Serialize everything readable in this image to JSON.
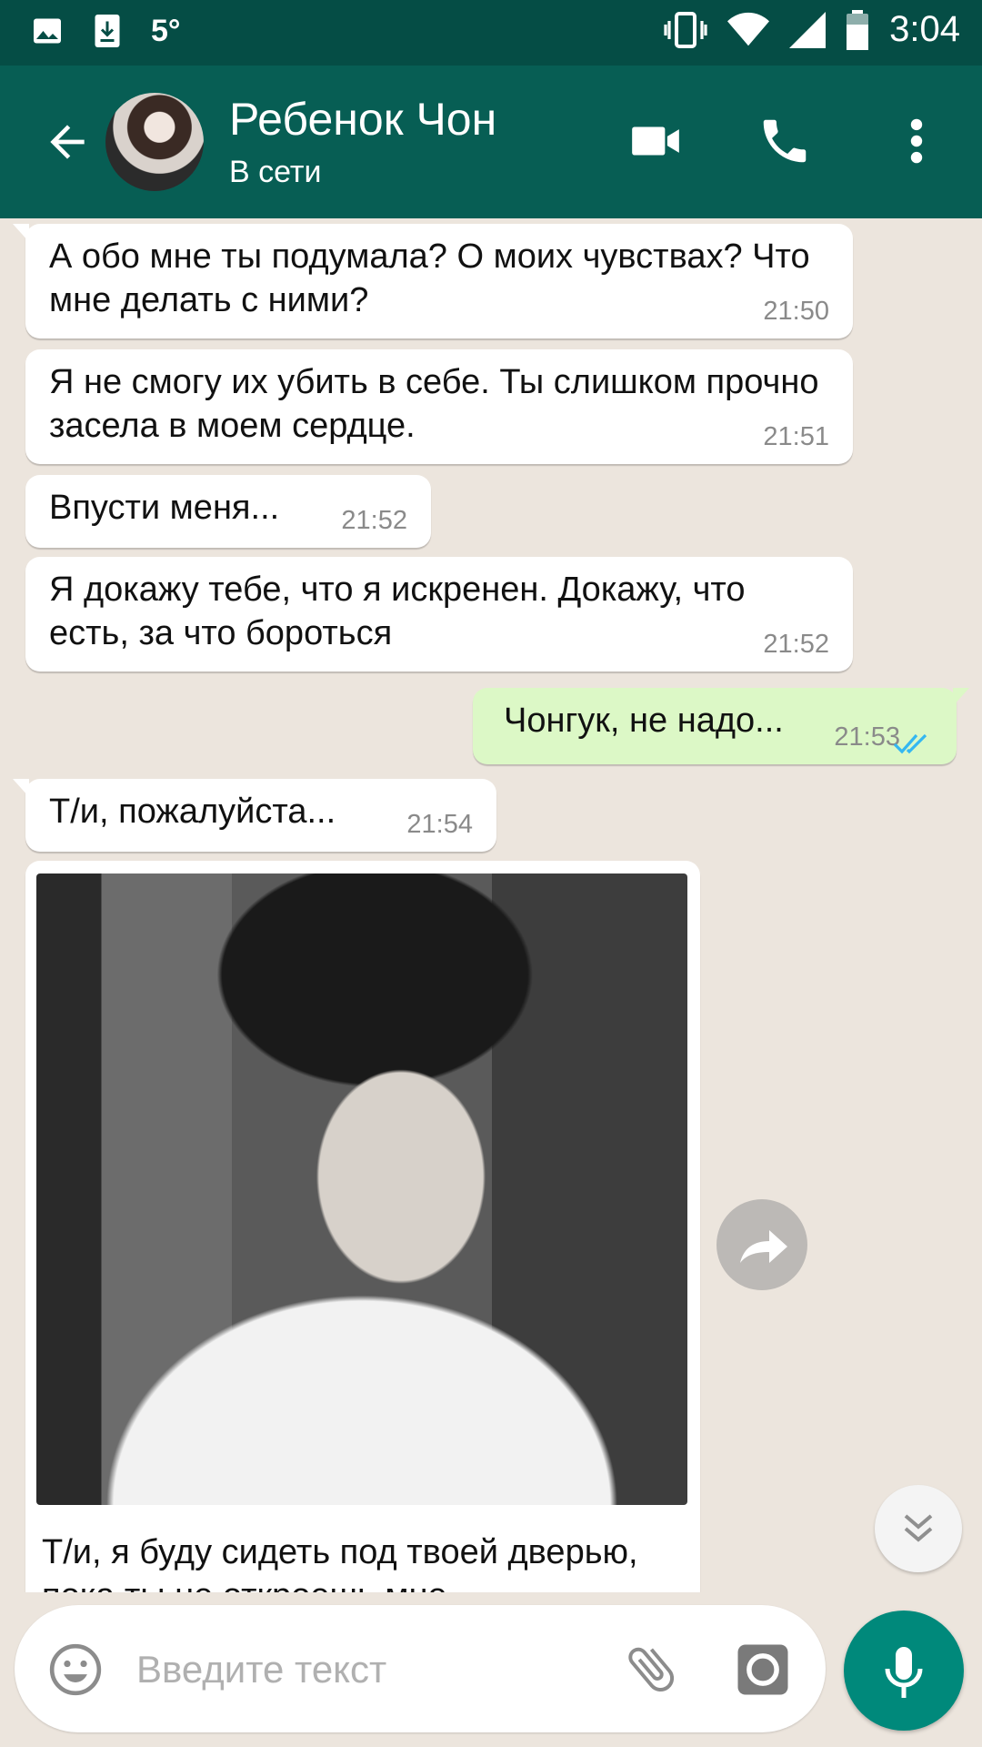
{
  "status_bar": {
    "temperature": "5°",
    "time": "3:04"
  },
  "header": {
    "contact_name": "Ребенок Чон",
    "contact_status": "В сети"
  },
  "messages": [
    {
      "text": "А обо мне ты подумала? О моих чувствах? Что мне делать с ними?",
      "time": "21:50"
    },
    {
      "text": "Я не смогу их убить в себе. Ты слишком прочно засела в моем сердце.",
      "time": "21:51"
    },
    {
      "text": "Впусти меня...",
      "time": "21:52"
    },
    {
      "text": "Я докажу тебе, что я искренен. Докажу, что есть, за что бороться",
      "time": "21:52"
    },
    {
      "text": "Чонгук, не надо...",
      "time": "21:53"
    },
    {
      "text": "Т/и, пожалуйста...",
      "time": "21:54"
    },
    {
      "caption": "Т/и, я буду сидеть под твоей дверью, пока ты не откроешь мне"
    }
  ],
  "input": {
    "placeholder": "Введите текст"
  },
  "colors": {
    "header": "#075e54",
    "status_bar": "#054d45",
    "outgoing_bubble": "#dcf8c6",
    "mic_button": "#00897b",
    "read_ticks": "#34b7f1"
  }
}
